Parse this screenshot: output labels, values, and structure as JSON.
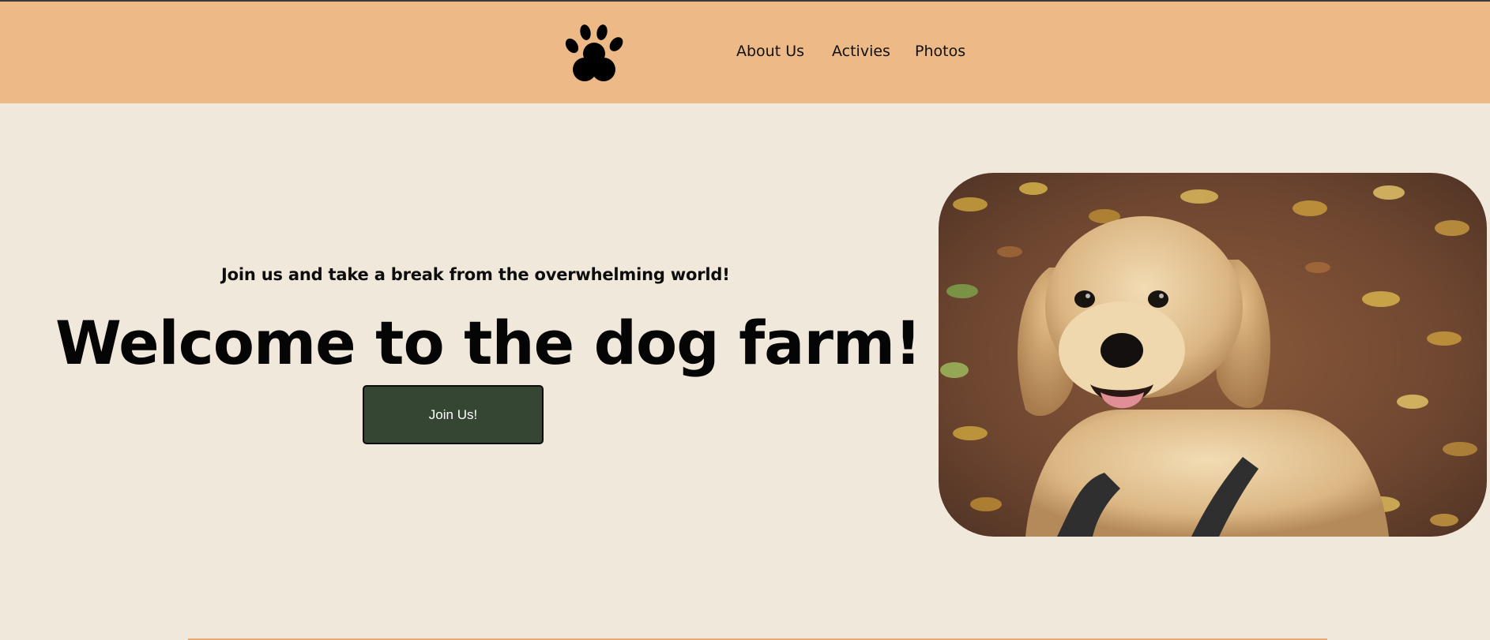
{
  "header": {
    "logo_icon": "paw-icon",
    "nav": {
      "about": "About Us",
      "activities": "Activies",
      "photos": "Photos"
    },
    "bg_color": "#edb986"
  },
  "hero": {
    "tagline": "Join us and take a break from the overwhelming world!",
    "headline": "Welcome to the dog farm!",
    "button_label": "Join Us!",
    "button_color": "#354632",
    "photo_subject": "golden-retriever-in-autumn-leaves"
  },
  "page": {
    "bg_color": "#f1e8dc"
  }
}
